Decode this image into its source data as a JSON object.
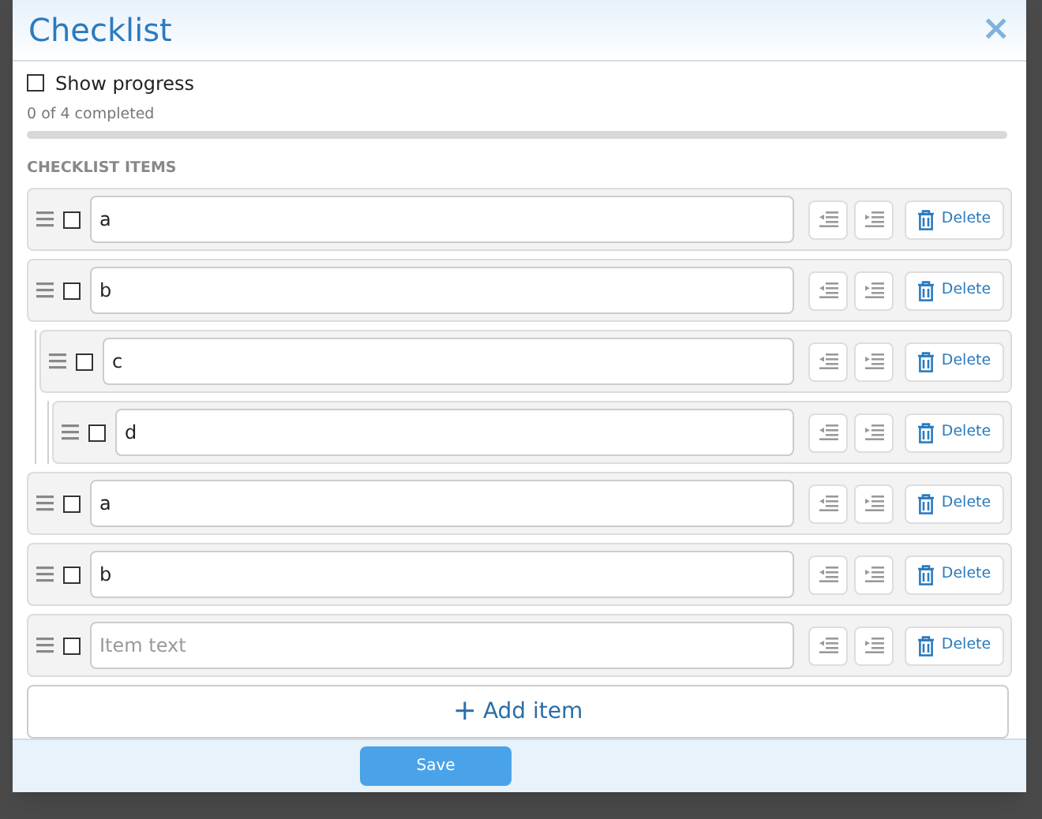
{
  "dialog": {
    "title": "Checklist",
    "close": "×"
  },
  "show_progress": {
    "label": "Show progress",
    "checked": false
  },
  "progress": {
    "text": "0 of 4 completed",
    "level": 0
  },
  "section_title": "CHECKLIST ITEMS",
  "items": [
    {
      "text": "a",
      "checked": false,
      "delete": "Delete"
    },
    {
      "text": "b",
      "checked": false,
      "delete": "Delete",
      "children": [
        {
          "text": "c",
          "checked": false,
          "delete": "Delete",
          "children": [
            {
              "text": "d",
              "checked": false,
              "delete": "Delete"
            }
          ]
        }
      ]
    },
    {
      "text": "a",
      "checked": false,
      "delete": "Delete"
    },
    {
      "text": "b",
      "checked": false,
      "delete": "Delete"
    },
    {
      "placeholder": "Item text",
      "checked": false,
      "delete": "Delete"
    }
  ],
  "add_item": {
    "icon": "+",
    "label": "Add item"
  },
  "save": "Save"
}
